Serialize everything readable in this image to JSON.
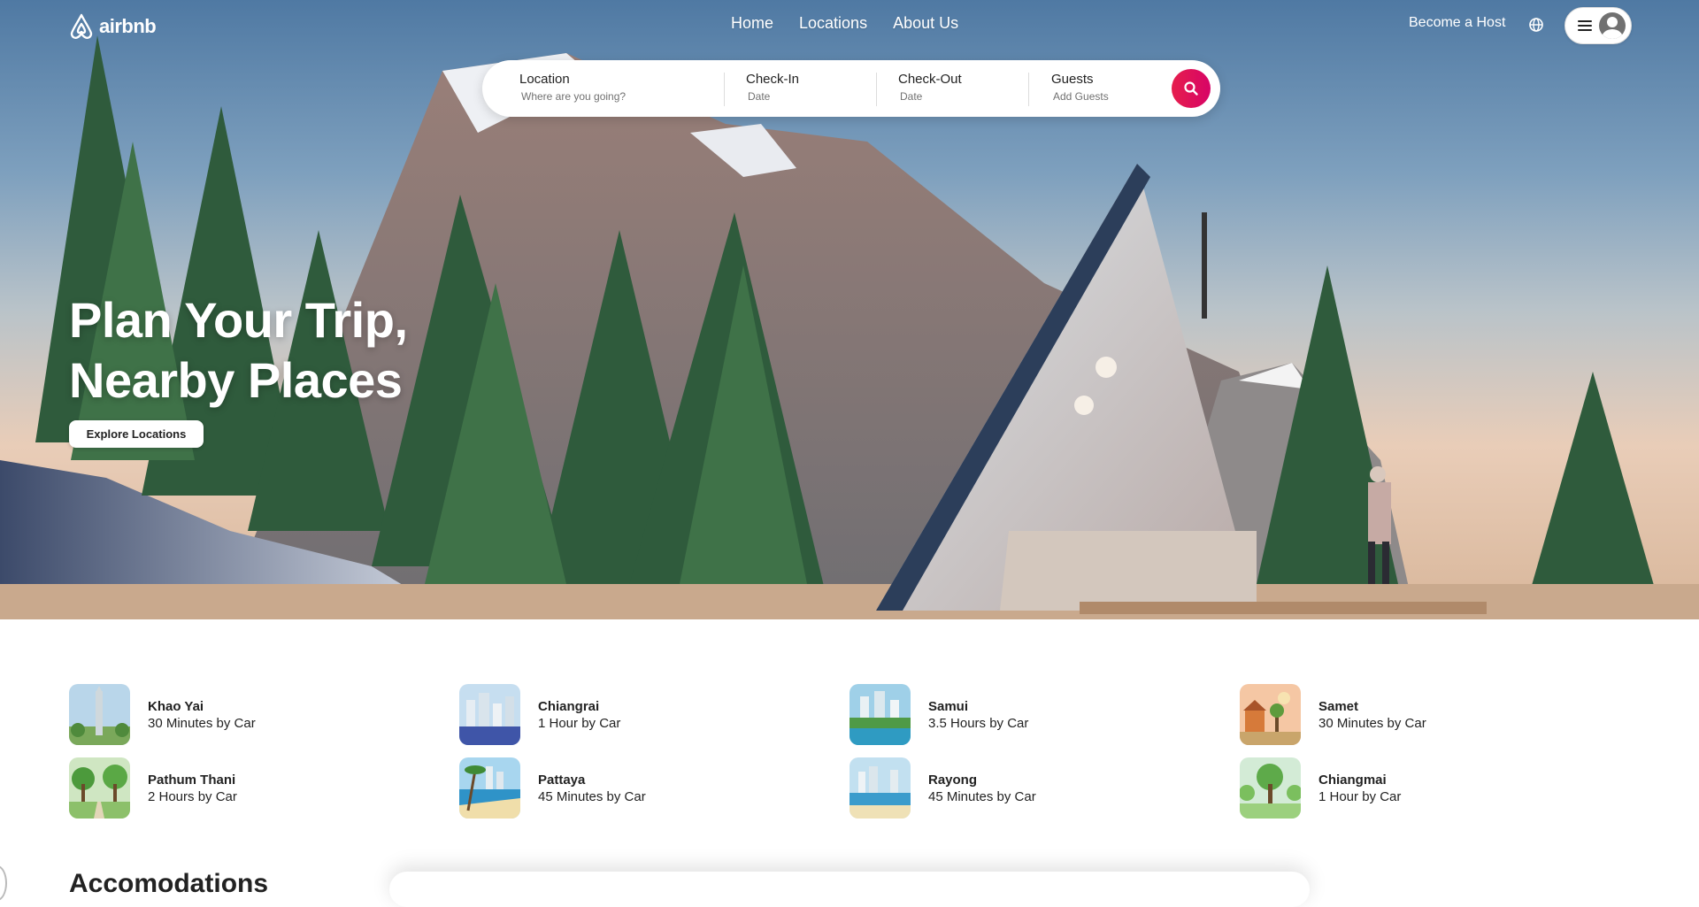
{
  "brand": {
    "name": "airbnb",
    "accent": "#e61e4d"
  },
  "nav": {
    "links": [
      "Home",
      "Locations",
      "About Us"
    ],
    "become_host": "Become a Host",
    "globe_icon": "globe-icon",
    "menu_icon": "hamburger-icon",
    "avatar_icon": "user-avatar-icon"
  },
  "search": {
    "location_label": "Location",
    "location_value": "Where are you going?",
    "checkin_label": "Check-In",
    "checkin_value": "Date",
    "checkout_label": "Check-Out",
    "checkout_value": "Date",
    "guests_label": "Guests",
    "guests_value": "Add Guests",
    "button_icon": "search-icon"
  },
  "hero": {
    "title_line1": "Plan Your Trip,",
    "title_line2": "Nearby Places",
    "cta": "Explore Locations"
  },
  "nearby": [
    {
      "name": "Khao Yai",
      "time": "30 Minutes by Car"
    },
    {
      "name": "Chiangrai",
      "time": "1 Hour by Car"
    },
    {
      "name": "Samui",
      "time": "3.5 Hours by Car"
    },
    {
      "name": "Samet",
      "time": "30 Minutes by Car"
    },
    {
      "name": "Pathum Thani",
      "time": "2 Hours by Car"
    },
    {
      "name": "Pattaya",
      "time": "45 Minutes by Car"
    },
    {
      "name": "Rayong",
      "time": "45 Minutes by Car"
    },
    {
      "name": "Chiangmai",
      "time": "1 Hour by Car"
    }
  ],
  "accommodations": {
    "title": "Accomodations"
  }
}
